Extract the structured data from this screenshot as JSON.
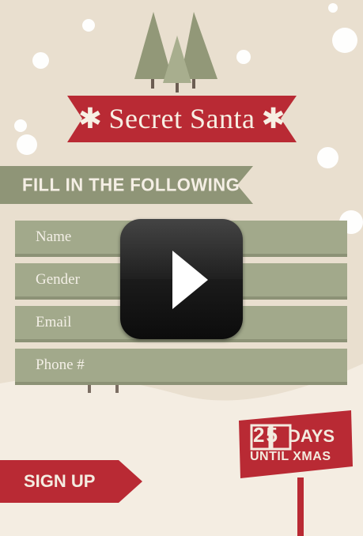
{
  "header": {
    "title": "Secret Santa",
    "subtitle": "FILL IN THE FOLLOWING"
  },
  "form": {
    "fields": [
      {
        "label": "Name"
      },
      {
        "label": "Gender"
      },
      {
        "label": "Email"
      },
      {
        "label": "Phone #"
      }
    ]
  },
  "actions": {
    "signup_label": "SIGN UP",
    "play_icon": "play-icon"
  },
  "countdown": {
    "number": "25",
    "unit": "DAYS",
    "caption": "UNTIL XMAS"
  },
  "colors": {
    "background": "#e9dfcf",
    "accent_red": "#b92a34",
    "sage": "#a2a98b",
    "tree_green": "#939a7c",
    "text_light": "#f4ece1"
  }
}
